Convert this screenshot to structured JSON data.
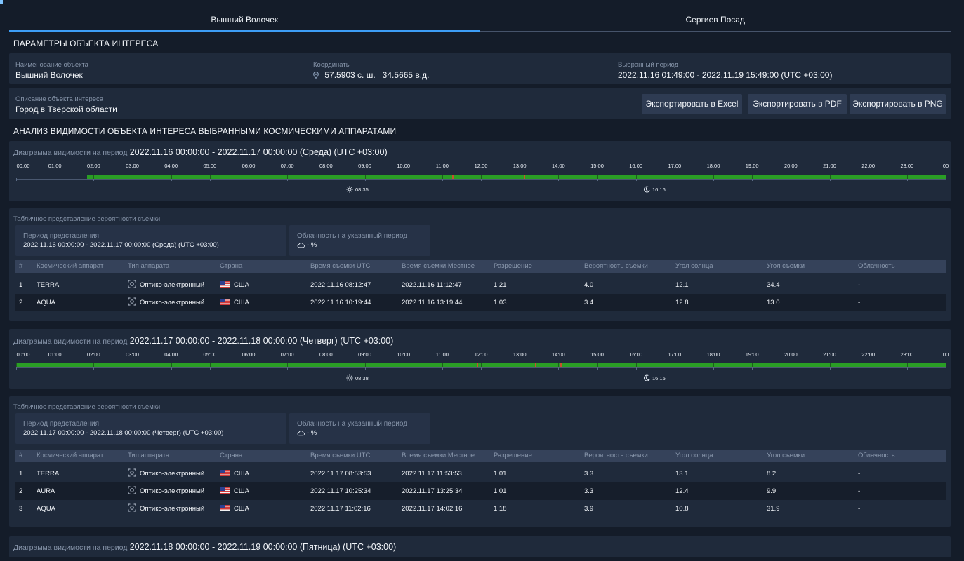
{
  "tabs": [
    {
      "label": "Вышний Волочек",
      "active": true
    },
    {
      "label": "Сергиев Посад",
      "active": false
    }
  ],
  "params": {
    "title": "ПАРАМЕТРЫ ОБЪЕКТА ИНТЕРЕСА",
    "name_label": "Наименование объекта",
    "name_value": "Вышний Волочек",
    "coords_label": "Координаты",
    "coords_value": "57.5903 с. ш.   34.5665 в.д.",
    "period_label": "Выбранный период",
    "period_value": "2022.11.16 01:49:00 - 2022.11.19 15:49:00 (UTC +03:00)",
    "desc_label": "Описание объекта интереса",
    "desc_value": "Город в Тверской области"
  },
  "export": {
    "excel": "Экспортировать в Excel",
    "pdf": "Экспортировать в PDF",
    "png": "Экспортировать в PNG"
  },
  "analysis_title": "АНАЛИЗ ВИДИМОСТИ ОБЪЕКТА ИНТЕРЕСА ВЫБРАННЫМИ КОСМИЧЕСКИМИ АППАРАТАМИ",
  "hours": [
    "00:00",
    "01:00",
    "02:00",
    "03:00",
    "04:00",
    "05:00",
    "06:00",
    "07:00",
    "08:00",
    "09:00",
    "10:00",
    "11:00",
    "12:00",
    "13:00",
    "14:00",
    "15:00",
    "16:00",
    "17:00",
    "18:00",
    "19:00",
    "20:00",
    "21:00",
    "22:00",
    "23:00",
    "00"
  ],
  "table_headers": [
    "#",
    "Космический аппарат",
    "Тип аппарата",
    "Страна",
    "Время съемки UTC",
    "Время съемки Местное",
    "Разрешение",
    "Вероятность съемки",
    "Угол солнца",
    "Угол съемки",
    "Облачность"
  ],
  "days": [
    {
      "chart_label": "Диаграмма видимости на период",
      "chart_period": "2022.11.16 00:00:00 - 2022.11.17 00:00:00 (Среда) (UTC +03:00)",
      "visible_from_hour": 1.833,
      "visible_to_hour": 24,
      "marks_hours": [
        11.25,
        13.1
      ],
      "sunrise": "08:35",
      "sunset": "16:16",
      "table_title": "Табличное представление вероятности съемки",
      "rep_label": "Период представления",
      "rep_value": "2022.11.16 00:00:00 - 2022.11.17 00:00:00 (Среда) (UTC +03:00)",
      "cloud_label": "Облачность на указанный период",
      "cloud_value": "- %",
      "rows": [
        [
          "1",
          "TERRA",
          "Оптико-электронный",
          "США",
          "2022.11.16 08:12:47",
          "2022.11.16 11:12:47",
          "1.21",
          "4.0",
          "12.1",
          "34.4",
          "-"
        ],
        [
          "2",
          "AQUA",
          "Оптико-электронный",
          "США",
          "2022.11.16 10:19:44",
          "2022.11.16 13:19:44",
          "1.03",
          "3.4",
          "12.8",
          "13.0",
          "-"
        ]
      ]
    },
    {
      "chart_label": "Диаграмма видимости на период",
      "chart_period": "2022.11.17 00:00:00 - 2022.11.18 00:00:00 (Четверг) (UTC +03:00)",
      "visible_from_hour": 0,
      "visible_to_hour": 24,
      "marks_hours": [
        11.9,
        13.4,
        14.05
      ],
      "sunrise": "08:38",
      "sunset": "16:15",
      "table_title": "Табличное представление вероятности съемки",
      "rep_label": "Период представления",
      "rep_value": "2022.11.17 00:00:00 - 2022.11.18 00:00:00 (Четверг) (UTC +03:00)",
      "cloud_label": "Облачность на указанный период",
      "cloud_value": "- %",
      "rows": [
        [
          "1",
          "TERRA",
          "Оптико-электронный",
          "США",
          "2022.11.17 08:53:53",
          "2022.11.17 11:53:53",
          "1.01",
          "3.3",
          "13.1",
          "8.2",
          "-"
        ],
        [
          "2",
          "AURA",
          "Оптико-электронный",
          "США",
          "2022.11.17 10:25:34",
          "2022.11.17 13:25:34",
          "1.01",
          "3.3",
          "12.4",
          "9.9",
          "-"
        ],
        [
          "3",
          "AQUA",
          "Оптико-электронный",
          "США",
          "2022.11.17 11:02:16",
          "2022.11.17 14:02:16",
          "1.18",
          "3.9",
          "10.8",
          "31.9",
          "-"
        ]
      ]
    },
    {
      "chart_label": "Диаграмма видимости на период",
      "chart_period": "2022.11.18 00:00:00 - 2022.11.19 00:00:00 (Пятница) (UTC +03:00)"
    }
  ]
}
